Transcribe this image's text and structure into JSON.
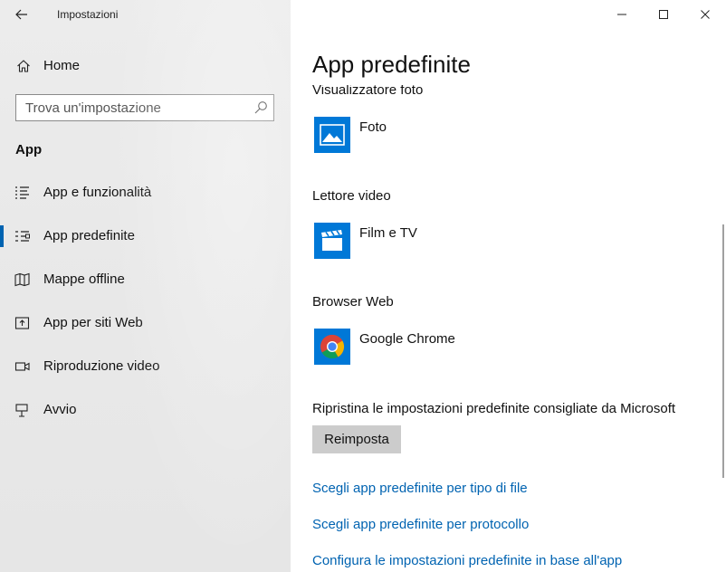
{
  "window": {
    "title": "Impostazioni",
    "controls": {
      "minimize": "minimize-icon",
      "maximize": "maximize-icon",
      "close": "close-icon"
    }
  },
  "sidebar": {
    "home_label": "Home",
    "search": {
      "placeholder": "Trova un'impostazione",
      "value": ""
    },
    "section_title": "App",
    "items": [
      {
        "label": "App e funzionalità",
        "icon": "list-icon",
        "active": false
      },
      {
        "label": "App predefinite",
        "icon": "default-apps-icon",
        "active": true
      },
      {
        "label": "Mappe offline",
        "icon": "map-icon",
        "active": false
      },
      {
        "label": "App per siti Web",
        "icon": "web-app-icon",
        "active": false
      },
      {
        "label": "Riproduzione video",
        "icon": "video-icon",
        "active": false
      },
      {
        "label": "Avvio",
        "icon": "startup-icon",
        "active": false
      }
    ]
  },
  "main": {
    "page_title": "App predefinite",
    "categories": [
      {
        "label": "Visualizzatore foto",
        "app": "Foto",
        "icon": "photos-icon"
      },
      {
        "label": "Lettore video",
        "app": "Film e TV",
        "icon": "movies-tv-icon"
      },
      {
        "label": "Browser Web",
        "app": "Google Chrome",
        "icon": "chrome-icon"
      }
    ],
    "reset": {
      "label": "Ripristina le impostazioni predefinite consigliate da Microsoft",
      "button": "Reimposta"
    },
    "links": [
      "Scegli app predefinite per tipo di file",
      "Scegli app predefinite per protocollo",
      "Configura le impostazioni predefinite in base all'app"
    ]
  },
  "colors": {
    "accent": "#0063b1",
    "tile": "#0078d7",
    "sidebar_bg": "#e9e9e9",
    "button_bg": "#cccccc"
  }
}
